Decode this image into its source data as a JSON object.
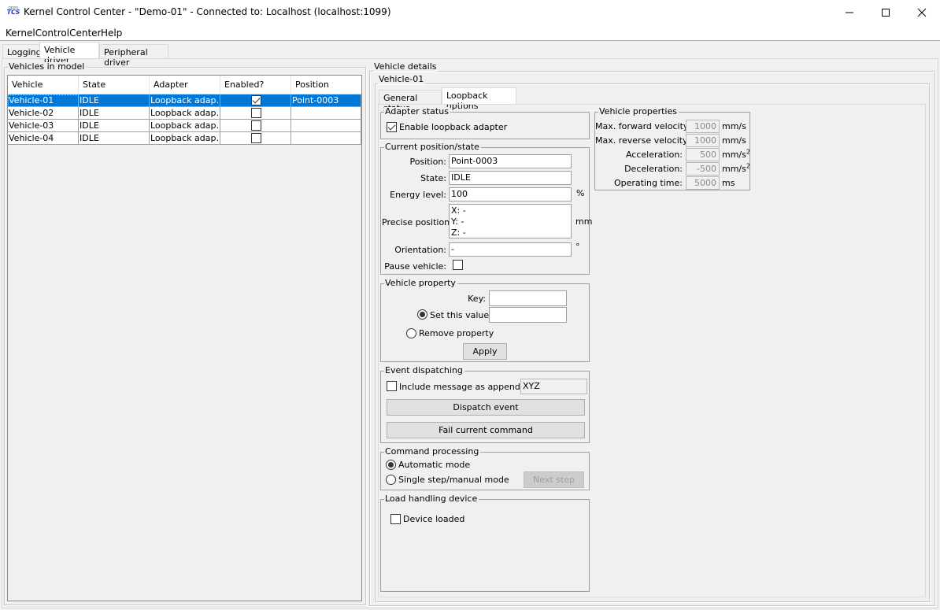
{
  "window": {
    "title": "Kernel Control Center - \"Demo-01\" - Connected to: Localhost (localhost:1099)",
    "app_icon_top": "open",
    "app_icon_bottom": "TCS",
    "controls": [
      "minimize-icon",
      "maximize-icon",
      "close-icon"
    ]
  },
  "menu": {
    "items": [
      {
        "label": "KernelControlCenter"
      },
      {
        "label": "Help"
      }
    ]
  },
  "tabs": [
    {
      "label": "Logging",
      "active": false
    },
    {
      "label": "Vehicle driver",
      "active": true
    },
    {
      "label": "Peripheral driver",
      "active": false
    }
  ],
  "vehicles_panel": {
    "title": "Vehicles in model",
    "columns": [
      "Vehicle",
      "State",
      "Adapter",
      "Enabled?",
      "Position"
    ],
    "rows": [
      {
        "vehicle": "Vehicle-01",
        "state": "IDLE",
        "adapter": "Loopback adap…",
        "enabled": true,
        "position": "Point-0003",
        "selected": true
      },
      {
        "vehicle": "Vehicle-02",
        "state": "IDLE",
        "adapter": "Loopback adap…",
        "enabled": false,
        "position": "",
        "selected": false
      },
      {
        "vehicle": "Vehicle-03",
        "state": "IDLE",
        "adapter": "Loopback adap…",
        "enabled": false,
        "position": "",
        "selected": false
      },
      {
        "vehicle": "Vehicle-04",
        "state": "IDLE",
        "adapter": "Loopback adap…",
        "enabled": false,
        "position": "",
        "selected": false
      }
    ]
  },
  "details": {
    "title": "Vehicle details",
    "vehicle_name": "Vehicle-01",
    "tabs": [
      {
        "label": "General status",
        "active": false
      },
      {
        "label": "Loopback options",
        "active": true
      }
    ],
    "adapter_status": {
      "title": "Adapter status",
      "enable_label": "Enable loopback adapter",
      "enabled": true
    },
    "current_position": {
      "title": "Current position/state",
      "position_label": "Position:",
      "position_value": "Point-0003",
      "state_label": "State:",
      "state_value": "IDLE",
      "energy_label": "Energy level:",
      "energy_value": "100",
      "energy_unit": "%",
      "precise_label": "Precise position:",
      "precise_x": "X: -",
      "precise_y": "Y: -",
      "precise_z": "Z: -",
      "precise_unit": "mm",
      "orientation_label": "Orientation:",
      "orientation_value": "-",
      "orientation_unit": "°",
      "pause_label": "Pause vehicle:",
      "paused": false
    },
    "vehicle_property": {
      "title": "Vehicle property",
      "key_label": "Key:",
      "key_value": "",
      "set_label": "Set this value:",
      "set_value": "",
      "set_selected": true,
      "remove_label": "Remove property",
      "apply_label": "Apply"
    },
    "event_dispatching": {
      "title": "Event dispatching",
      "include_label": "Include message as appendix:",
      "include_checked": false,
      "appendix_value": "XYZ",
      "dispatch_label": "Dispatch event",
      "fail_label": "Fail current command"
    },
    "command_processing": {
      "title": "Command processing",
      "auto_label": "Automatic mode",
      "auto_selected": true,
      "manual_label": "Single step/manual mode",
      "next_label": "Next step"
    },
    "load_handling": {
      "title": "Load handling device",
      "loaded_label": "Device loaded",
      "loaded": false
    },
    "vehicle_properties": {
      "title": "Vehicle properties",
      "items": [
        {
          "label": "Max. forward velocity:",
          "value": "1000",
          "unit": "mm/s",
          "sup": ""
        },
        {
          "label": "Max. reverse velocity:",
          "value": "1000",
          "unit": "mm/s",
          "sup": ""
        },
        {
          "label": "Acceleration:",
          "value": "500",
          "unit": "mm/s",
          "sup": "2"
        },
        {
          "label": "Deceleration:",
          "value": "-500",
          "unit": "mm/s",
          "sup": "2"
        },
        {
          "label": "Operating time:",
          "value": "5000",
          "unit": "ms",
          "sup": ""
        }
      ]
    }
  },
  "colors": {
    "selection": "#0078d7",
    "background": "#f0f0f0",
    "app_icon": "#1b3fbf"
  }
}
